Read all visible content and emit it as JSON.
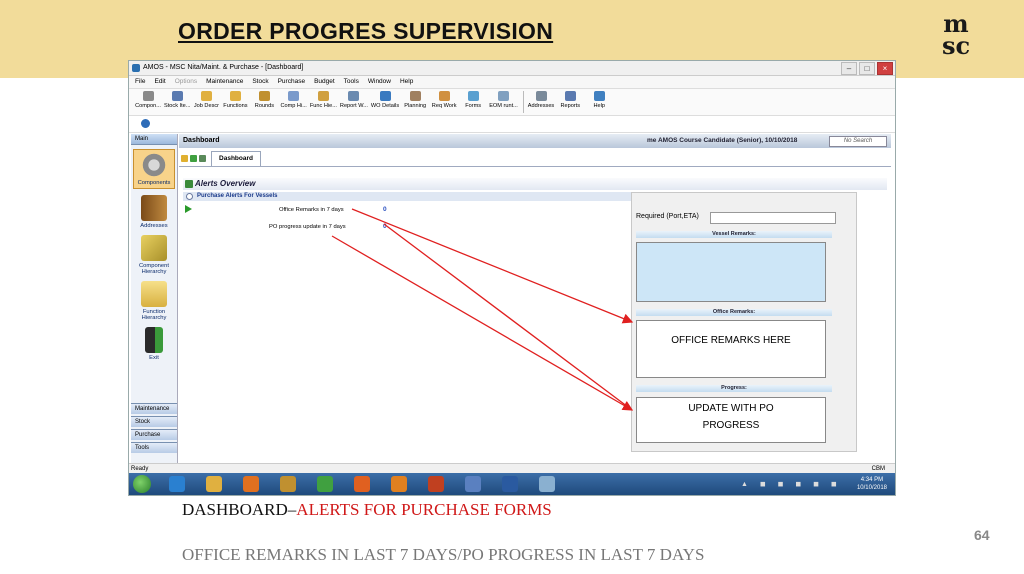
{
  "slide": {
    "title": "ORDER PROGRES SUPERVISION",
    "logo_line1": "m",
    "logo_line2": "sc",
    "caption_prefix": "DASHBOARD–",
    "caption_highlight": "ALERTS FOR  PURCHASE FORMS",
    "caption_second": "OFFICE REMARKS IN LAST 7 DAYS/PO PROGRESS IN LAST 7 DAYS",
    "page_number": "64"
  },
  "window": {
    "title": "AMOS - MSC Nita/Maint. & Purchase - [Dashboard]",
    "min": "–",
    "max": "□",
    "close": "×"
  },
  "menu": [
    "File",
    "Edit",
    "Options",
    "Maintenance",
    "Stock",
    "Purchase",
    "Budget",
    "Tools",
    "Window",
    "Help"
  ],
  "toolbar": [
    {
      "label": "Compon...",
      "icon": "component-icon",
      "color": "#8a8a8a"
    },
    {
      "label": "Stock Ite...",
      "icon": "stock-item-icon",
      "color": "#5a7ab0"
    },
    {
      "label": "Job Descr",
      "icon": "folder-icon",
      "color": "#e0b040"
    },
    {
      "label": "Functions",
      "icon": "folder-icon",
      "color": "#e0b040"
    },
    {
      "label": "Rounds",
      "icon": "rounds-icon",
      "color": "#c09030"
    },
    {
      "label": "Comp Hi...",
      "icon": "hierarchy-icon",
      "color": "#7a9acb"
    },
    {
      "label": "Func Hie...",
      "icon": "hierarchy-icon",
      "color": "#d0a040"
    },
    {
      "label": "Report W...",
      "icon": "report-icon",
      "color": "#6a8ab0"
    },
    {
      "label": "WO Details",
      "icon": "wo-details-icon",
      "color": "#3a7ac0"
    },
    {
      "label": "Planning",
      "icon": "planning-icon",
      "color": "#a08060"
    },
    {
      "label": "Req Work",
      "icon": "req-work-icon",
      "color": "#d09040"
    },
    {
      "label": "Forms",
      "icon": "forms-icon",
      "color": "#5aa0d0"
    },
    {
      "label": "EOM runt...",
      "icon": "eom-icon",
      "color": "#80a0c0"
    },
    {
      "label": "Addresses",
      "icon": "addresses-icon",
      "color": "#7a8a9a"
    },
    {
      "label": "Reports",
      "icon": "reports-icon",
      "color": "#5a7ab0"
    },
    {
      "label": "Help",
      "icon": "help-icon",
      "color": "#4080c0"
    }
  ],
  "sidebar": {
    "header": "Main",
    "items": [
      {
        "label": "Components",
        "icon": "gear-icon",
        "color": "#8a8a8a"
      },
      {
        "label": "Addresses",
        "icon": "addresses-book-icon",
        "color": "#b07a30"
      },
      {
        "label": "Component Hierarchy",
        "icon": "hierarchy-icon",
        "color": "#c8b040"
      },
      {
        "label": "Function Hierarchy",
        "icon": "function-folder-icon",
        "color": "#e0c050"
      },
      {
        "label": "Exit",
        "icon": "exit-door-icon",
        "color": "#3a9a3a"
      }
    ],
    "bottom": [
      "Maintenance",
      "Stock",
      "Purchase",
      "Tools"
    ]
  },
  "dashboard": {
    "header": "Dashboard",
    "user": "me AMOS Course Candidate (Senior), 10/10/2018",
    "search_placeholder": "No Search",
    "tab": "Dashboard",
    "alerts_title": "Alerts Overview",
    "purchase_header": "Purchase Alerts For Vessels",
    "alerts": [
      {
        "label": "Office Remarks in 7 days",
        "count": "0"
      },
      {
        "label": "PO progress update in 7 days",
        "count": "0"
      }
    ]
  },
  "form": {
    "required_label": "Required (Port,ETA)",
    "vessel_header": "Vessel Remarks:",
    "office_header": "Office Remarks:",
    "office_text": "OFFICE REMARKS HERE",
    "progress_header": "Progress:",
    "progress_text": "UPDATE WITH PO PROGRESS"
  },
  "status": {
    "left": "Ready",
    "right": "CBM"
  },
  "taskbar": {
    "time": "4:34 PM",
    "date": "10/10/2018",
    "apps": [
      {
        "icon": "internet-explorer-icon",
        "color": "#2a80d0"
      },
      {
        "icon": "file-explorer-icon",
        "color": "#e0b040"
      },
      {
        "icon": "media-player-icon",
        "color": "#e07020"
      },
      {
        "icon": "geometry-icon",
        "color": "#c09030"
      },
      {
        "icon": "chrome-icon",
        "color": "#40a040"
      },
      {
        "icon": "firefox-icon",
        "color": "#e06020"
      },
      {
        "icon": "outlook-icon",
        "color": "#e08020"
      },
      {
        "icon": "powerpoint-icon",
        "color": "#c04020"
      },
      {
        "icon": "network-icon",
        "color": "#5a80c0"
      },
      {
        "icon": "word-icon",
        "color": "#2a5aa0"
      },
      {
        "icon": "ship-app-icon",
        "color": "#8ab0d0"
      }
    ]
  },
  "colors": {
    "banner": "#f2dc9a",
    "highlight_red": "#d01818",
    "arrow_red": "#e02020"
  }
}
